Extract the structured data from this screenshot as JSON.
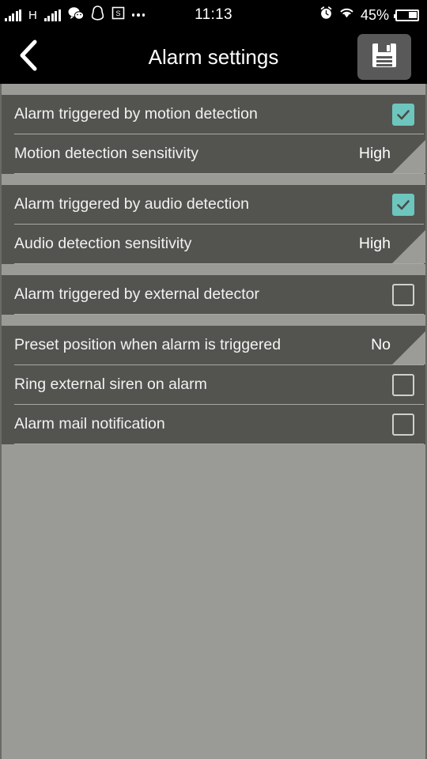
{
  "statusbar": {
    "signal_left_icon": "signal-bars-icon",
    "network_type": "H",
    "signal_right_icon": "signal-bars-icon",
    "app_icons": [
      "wechat-icon",
      "qq-icon",
      "screenshot-icon",
      "more-dots-icon"
    ],
    "time": "11:13",
    "alarm_icon": "alarm-clock-icon",
    "wifi_icon": "wifi-icon",
    "battery_percent": "45%",
    "battery_icon": "battery-icon"
  },
  "titlebar": {
    "back_icon": "back-chevron-icon",
    "title": "Alarm settings",
    "save_icon": "save-floppy-icon"
  },
  "colors": {
    "row_background": "#535350",
    "page_background": "#9a9a96",
    "checkbox_checked": "#6dc6bd",
    "titlebar_background": "#000000",
    "text": "#f2f2f2"
  },
  "groups": [
    {
      "rows": [
        {
          "label": "Alarm triggered by motion detection",
          "control": "checkbox",
          "checked": true
        },
        {
          "label": "Motion detection sensitivity",
          "control": "value",
          "value": "High",
          "has_corner": true
        }
      ]
    },
    {
      "rows": [
        {
          "label": "Alarm triggered by audio detection",
          "control": "checkbox",
          "checked": true
        },
        {
          "label": "Audio detection sensitivity",
          "control": "value",
          "value": "High",
          "has_corner": true
        }
      ]
    },
    {
      "rows": [
        {
          "label": "Alarm triggered by external detector",
          "control": "checkbox",
          "checked": false
        }
      ]
    },
    {
      "rows": [
        {
          "label": "Preset position when alarm is triggered",
          "control": "value",
          "value": "No",
          "has_corner": true
        },
        {
          "label": "Ring external siren on alarm",
          "control": "checkbox",
          "checked": false
        },
        {
          "label": "Alarm mail notification",
          "control": "checkbox",
          "checked": false
        }
      ]
    }
  ]
}
